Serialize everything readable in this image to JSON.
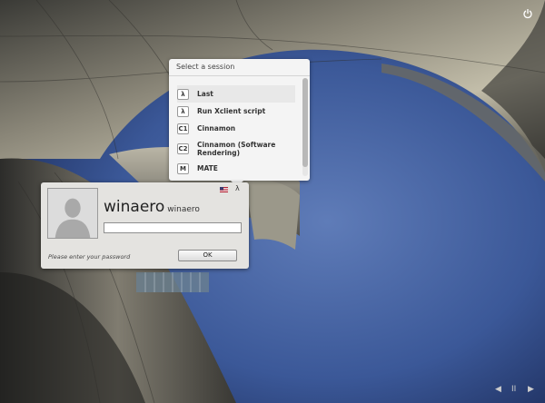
{
  "background": {
    "description_icon": "wallpaper-architecture"
  },
  "top_bar": {
    "power_icon": "power-icon"
  },
  "session_menu": {
    "header": "Select a session",
    "items": [
      {
        "icon": "λ",
        "label": "Last"
      },
      {
        "icon": "λ",
        "label": "Run Xclient script"
      },
      {
        "icon": "C1",
        "label": "Cinnamon"
      },
      {
        "icon": "C2",
        "label": "Cinnamon (Software Rendering)"
      },
      {
        "icon": "M",
        "label": "MATE"
      }
    ]
  },
  "login": {
    "username": "winaero",
    "realname": "winaero",
    "password_value": "",
    "prompt": "Please enter your password",
    "ok_label": "OK",
    "session_button": "λ",
    "flag_icon": "us-flag-icon"
  },
  "bottom_nav": {
    "prev": "◀",
    "pause": "II",
    "next": "▶"
  }
}
